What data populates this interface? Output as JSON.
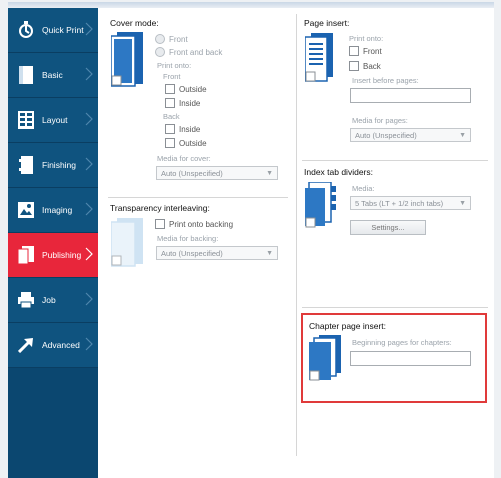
{
  "nav": {
    "items": [
      {
        "label": "Quick Print",
        "icon": "quick-print-icon"
      },
      {
        "label": "Basic",
        "icon": "basic-page-icon"
      },
      {
        "label": "Layout",
        "icon": "layout-grid-icon"
      },
      {
        "label": "Finishing",
        "icon": "finishing-icon"
      },
      {
        "label": "Imaging",
        "icon": "imaging-icon"
      },
      {
        "label": "Publishing",
        "icon": "publishing-icon",
        "active": true
      },
      {
        "label": "Job",
        "icon": "job-printer-icon"
      },
      {
        "label": "Advanced",
        "icon": "advanced-arrow-icon"
      }
    ]
  },
  "cover_mode": {
    "title": "Cover mode:",
    "front": "Front",
    "front_and_back": "Front and back",
    "print_onto": "Print onto:",
    "front_label": "Front",
    "front_outside": "Outside",
    "front_inside": "Inside",
    "back_label": "Back",
    "back_inside": "Inside",
    "back_outside": "Outside",
    "media_label": "Media for cover:",
    "media_value": "Auto (Unspecified)"
  },
  "transparency": {
    "title": "Transparency interleaving:",
    "print_onto_backing": "Print onto backing",
    "media_label": "Media for backing:",
    "media_value": "Auto (Unspecified)"
  },
  "page_insert": {
    "title": "Page insert:",
    "print_onto": "Print onto:",
    "front": "Front",
    "back": "Back",
    "insert_before": "Insert before pages:",
    "media_label": "Media for pages:",
    "media_value": "Auto (Unspecified)"
  },
  "index_tab": {
    "title": "Index tab dividers:",
    "media_label": "Media:",
    "media_value": "5 Tabs (LT + 1/2 inch tabs)",
    "settings_button": "Settings..."
  },
  "chapter": {
    "title": "Chapter page insert:",
    "beginning_label": "Beginning pages for chapters:"
  },
  "colors": {
    "sidebar": "#0f537f",
    "active": "#e8263b",
    "highlight": "#e03a3a"
  }
}
